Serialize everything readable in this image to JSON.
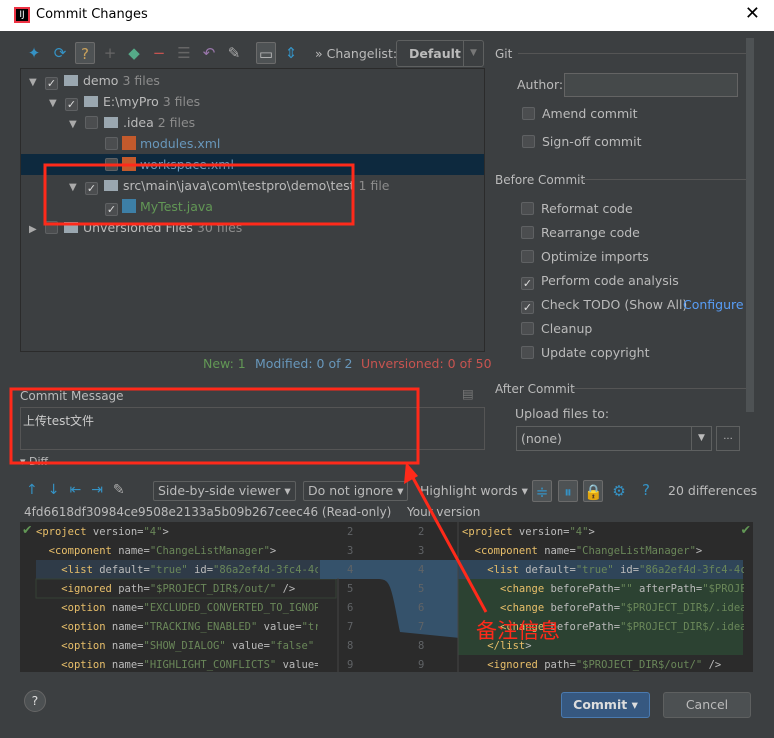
{
  "window": {
    "title": "Commit Changes",
    "close": "✕"
  },
  "toolbar": {
    "changelist_label": "Changelist:",
    "changelist_value": "Default",
    "git_label": "Git"
  },
  "tree": [
    {
      "name": "demo",
      "count": "3 files",
      "checked": true
    },
    {
      "name": "E:\\myPro",
      "count": "3 files",
      "checked": true
    },
    {
      "name": ".idea",
      "count": "2 files",
      "checked": false
    },
    {
      "name": "modules.xml",
      "count": "",
      "checked": false
    },
    {
      "name": "workspace.xml",
      "count": "",
      "checked": false
    },
    {
      "name": "src\\main\\java\\com\\testpro\\demo\\test",
      "count": "1 file",
      "checked": true
    },
    {
      "name": "MyTest.java",
      "count": "",
      "checked": true
    },
    {
      "name": "Unversioned Files",
      "count": "30 files",
      "checked": false
    }
  ],
  "status": {
    "new": "New: 1",
    "modified": "Modified: 0 of 2",
    "unversioned": "Unversioned: 0 of 50"
  },
  "commit_message": {
    "label": "Commit Message",
    "value": "上传test文件"
  },
  "diff": {
    "label": "Diff",
    "viewer": "Side-by-side viewer",
    "ignore": "Do not ignore",
    "highlight": "Highlight words",
    "differences": "20 differences",
    "left_title": "4fd6618df30984ce9508e2133a5b09b267ceec46 (Read-only)",
    "right_title": "Your version",
    "left_lines": [
      [
        "2",
        "<project version=\"4\">"
      ],
      [
        "3",
        "  <component name=\"ChangeListManager\">"
      ],
      [
        "4",
        "    <list default=\"true\" id=\"86a2ef4d-3fc4-4ca"
      ],
      [
        "5",
        "    <ignored path=\"$PROJECT_DIR$/out/\" />"
      ],
      [
        "6",
        "    <option name=\"EXCLUDED_CONVERTED_TO_IGNORE"
      ],
      [
        "7",
        "    <option name=\"TRACKING_ENABLED\" value=\"tru"
      ],
      [
        "8",
        "    <option name=\"SHOW_DIALOG\" value=\"false\" /"
      ],
      [
        "9",
        "    <option name=\"HIGHLIGHT_CONFLICTS\" value=\""
      ]
    ],
    "right_lines": [
      [
        "2",
        "<project version=\"4\">"
      ],
      [
        "3",
        "  <component name=\"ChangeListManager\">"
      ],
      [
        "4",
        "    <list default=\"true\" id=\"86a2ef4d-3fc4-4cab"
      ],
      [
        "5",
        "      <change beforePath=\"\" afterPath=\"$PROJEC"
      ],
      [
        "6",
        "      <change beforePath=\"$PROJECT_DIR$/.idea/"
      ],
      [
        "7",
        "      <change beforePath=\"$PROJECT_DIR$/.idea/wo"
      ],
      [
        "8",
        "    </list>"
      ],
      [
        "9",
        "    <ignored path=\"$PROJECT_DIR$/out/\" />"
      ]
    ]
  },
  "git": {
    "author_label": "Author:",
    "author_value": "",
    "amend": "Amend commit",
    "signoff": "Sign-off commit"
  },
  "before_commit": {
    "label": "Before Commit",
    "items": [
      {
        "label": "Reformat code",
        "checked": false
      },
      {
        "label": "Rearrange code",
        "checked": false
      },
      {
        "label": "Optimize imports",
        "checked": false
      },
      {
        "label": "Perform code analysis",
        "checked": true
      },
      {
        "label": "Check TODO (Show All)",
        "checked": true
      },
      {
        "label": "Cleanup",
        "checked": false
      },
      {
        "label": "Update copyright",
        "checked": false
      }
    ],
    "configure": "Configure"
  },
  "after_commit": {
    "label": "After Commit",
    "upload_label": "Upload files to:",
    "upload_value": "(none)",
    "more": "..."
  },
  "annotation": {
    "text": "备注信息",
    "color": "#ff2a1a"
  },
  "buttons": {
    "help": "?",
    "commit": "Commit",
    "cancel": "Cancel"
  }
}
